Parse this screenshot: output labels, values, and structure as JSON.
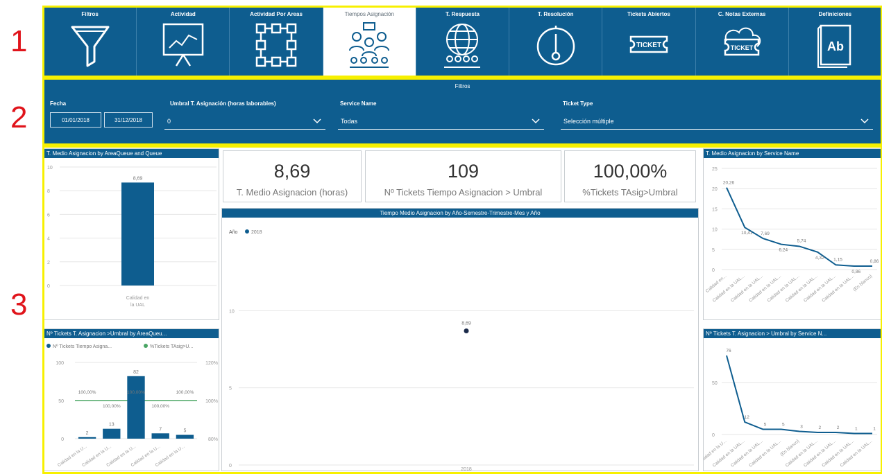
{
  "annotations": [
    "1",
    "2",
    "3"
  ],
  "colors": {
    "brand": "#0e5d8f",
    "highlight": "#f7f000",
    "annotation": "#e0141b",
    "series_green": "#4aa564"
  },
  "nav": {
    "tabs": [
      {
        "label": "Filtros",
        "icon": "funnel-icon",
        "active": false
      },
      {
        "label": "Actividad",
        "icon": "presentation-chart-icon",
        "active": false
      },
      {
        "label": "Actividad Por Areas",
        "icon": "network-nodes-icon",
        "active": false
      },
      {
        "label": "Tiempos Asignación",
        "icon": "team-meeting-icon",
        "active": true
      },
      {
        "label": "T. Respuesta",
        "icon": "globe-people-icon",
        "active": false
      },
      {
        "label": "T. Resolución",
        "icon": "stopwatch-icon",
        "active": false
      },
      {
        "label": "Tickets Abiertos",
        "icon": "ticket-icon",
        "active": false
      },
      {
        "label": "C. Notas Externas",
        "icon": "ticket-cloud-icon",
        "active": false
      },
      {
        "label": "Definiciones",
        "icon": "dictionary-book-icon",
        "active": false
      }
    ]
  },
  "filters": {
    "title": "Filtros",
    "fecha": {
      "label": "Fecha",
      "from": "01/01/2018",
      "to": "31/12/2018"
    },
    "umbral": {
      "label": "Umbral T. Asignación (horas laborables)",
      "value": "0"
    },
    "service": {
      "label": "Service Name",
      "value": "Todas"
    },
    "ticket": {
      "label": "Ticket Type",
      "value": "Selección múltiple"
    }
  },
  "kpis": [
    {
      "value": "8,69",
      "label": "T. Medio Asignacion (horas)"
    },
    {
      "value": "109",
      "label": "Nº Tickets Tiempo Asignacion > Umbral"
    },
    {
      "value": "100,00%",
      "label": "%Tickets TAsig>Umbral"
    }
  ],
  "panels": {
    "tl_title": "T. Medio Asignacion by AreaQueue and Queue",
    "bl_title": "Nº Tickets T. Asignacion >Umbral by AreaQueu...",
    "center_title": "Tiempo Medio Asignacion by Año-Semestre-Trimestre-Mes y Año",
    "tr_title": "T. Medio Asignacion by Service Name",
    "br_title": "Nº Tickets T. Asignacion > Umbral by Service N..."
  },
  "chart_data": [
    {
      "type": "bar",
      "title": "T. Medio Asignacion by AreaQueue and Queue",
      "categories": [
        "Calidad en la UAL"
      ],
      "values": [
        8.69
      ],
      "data_labels": [
        "8,69"
      ],
      "ylim": [
        0,
        10
      ],
      "yticks": [
        "10",
        "8",
        "6",
        "4",
        "2",
        "0"
      ]
    },
    {
      "type": "bar",
      "title": "Nº Tickets T. Asignacion >Umbral by AreaQueu...",
      "legend": [
        "Nº Tickets Tiempo Asigna...",
        "%Tickets TAsig>U..."
      ],
      "categories": [
        "Calidad en la U...",
        "Calidad en la U...",
        "Calidad en la U...",
        "Calidad en la U...",
        "Calidad en la U..."
      ],
      "series": [
        {
          "name": "Nº Tickets Tiempo Asigna...",
          "values": [
            2,
            13,
            82,
            7,
            5
          ]
        },
        {
          "name": "%Tickets TAsig>U...",
          "values": [
            100,
            100,
            100,
            100,
            100
          ]
        }
      ],
      "bar_labels": [
        "2",
        "13",
        "82",
        "7",
        "5"
      ],
      "pct_labels": [
        "100,00%",
        "100,00%",
        "100,00%",
        "100,00%",
        "100,00%"
      ],
      "ylim": [
        0,
        100
      ],
      "yticks_left": [
        "100",
        "50",
        "0"
      ],
      "yticks_right": [
        "120%",
        "100%",
        "80%"
      ]
    },
    {
      "type": "scatter",
      "title": "Tiempo Medio Asignacion by Año-Semestre-Trimestre-Mes y Año",
      "legend_title": "Año",
      "legend": [
        "2018"
      ],
      "x": [
        "2018"
      ],
      "values": [
        8.69
      ],
      "data_labels": [
        "8,69"
      ],
      "ylim": [
        0,
        15
      ],
      "yticks": [
        "10",
        "5",
        "0"
      ]
    },
    {
      "type": "line",
      "title": "T. Medio Asignacion by Service Name",
      "categories": [
        "Calidad en...",
        "Calidad en la UAL...",
        "Calidad en la UAL...",
        "Calidad en la UAL...",
        "Calidad en la UAL...",
        "Calidad en la UAL...",
        "Calidad en la UAL...",
        "Calidad en la UAL...",
        "(En blanco)"
      ],
      "values": [
        20.26,
        10.41,
        7.69,
        6.24,
        5.74,
        4.32,
        1.15,
        0.86,
        0.86
      ],
      "data_labels": [
        "20,26",
        "10,41",
        "7,69",
        "6,24",
        "5,74",
        "4,32",
        "1,15",
        "0,86",
        "0,86"
      ],
      "ylim": [
        0,
        25
      ],
      "yticks": [
        "25",
        "20",
        "15",
        "10",
        "5",
        "0"
      ]
    },
    {
      "type": "line",
      "title": "Nº Tickets T. Asignacion > Umbral by Service N...",
      "categories": [
        "Calidad en la U...",
        "Calidad en la UAL...",
        "Calidad en la UAL...",
        "Calidad en la UAL...",
        "(En blanco)",
        "Calidad en la UAL...",
        "Calidad en la UAL...",
        "Calidad en la UAL...",
        "Calidad en la UAL..."
      ],
      "values": [
        76,
        12,
        5,
        5,
        3,
        2,
        2,
        1,
        1
      ],
      "data_labels": [
        "76",
        "12",
        "5",
        "5",
        "3",
        "2",
        "2",
        "1",
        "1"
      ],
      "ylim": [
        0,
        80
      ],
      "yticks": [
        "50",
        "0"
      ]
    }
  ]
}
